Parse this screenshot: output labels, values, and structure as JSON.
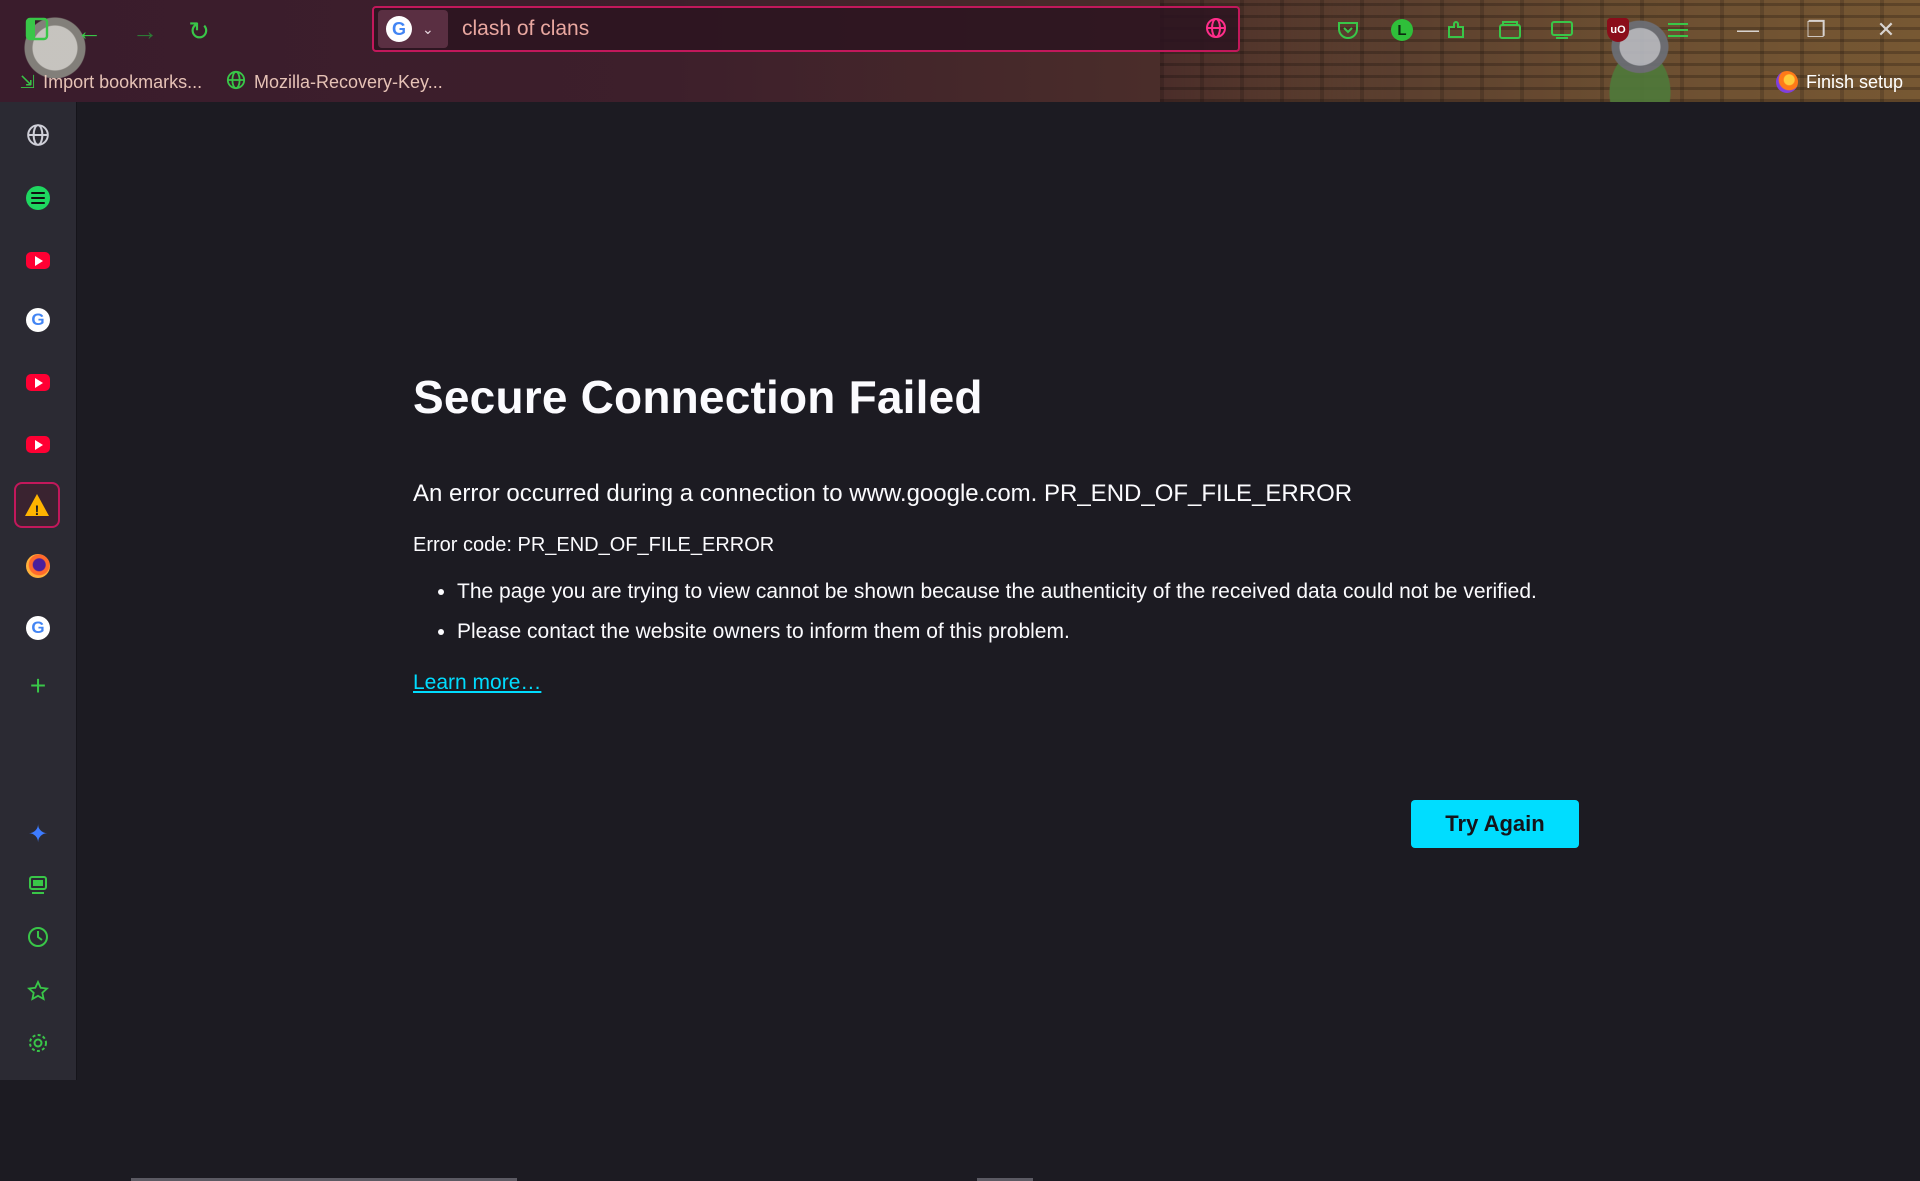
{
  "browser": {
    "url_text": "clash of clans",
    "search_engine_initial": "G",
    "chevron": "⌄"
  },
  "toolbar": {
    "back": "←",
    "forward": "→",
    "reload": "↻",
    "globe_icon": "globe-icon",
    "logo_initial": "L",
    "ublock_label": "uO"
  },
  "window_controls": {
    "minimize": "—",
    "restore": "❐",
    "close": "✕"
  },
  "bookmarks": [
    {
      "label": "Import bookmarks...",
      "icon": "import-icon"
    },
    {
      "label": "Mozilla-Recovery-Key...",
      "icon": "globe-icon"
    }
  ],
  "finish_setup": "Finish setup",
  "sidebar": {
    "items": [
      {
        "icon": "globe-icon"
      },
      {
        "icon": "spotify-icon"
      },
      {
        "icon": "youtube-icon"
      },
      {
        "icon": "google-icon"
      },
      {
        "icon": "youtube-icon"
      },
      {
        "icon": "youtube-icon"
      },
      {
        "icon": "warning-icon",
        "active": true
      },
      {
        "icon": "firefox-icon"
      },
      {
        "icon": "google-icon"
      },
      {
        "icon": "plus-icon"
      }
    ],
    "bottom": [
      "sparkle-icon",
      "extensions-icon",
      "history-icon",
      "star-icon",
      "settings-icon"
    ],
    "google_initial": "G",
    "warning_mark": "!"
  },
  "error": {
    "title": "Secure Connection Failed",
    "description": "An error occurred during a connection to www.google.com. PR_END_OF_FILE_ERROR",
    "code_line": "Error code: PR_END_OF_FILE_ERROR",
    "bullets": [
      "The page you are trying to view cannot be shown because the authenticity of the received data could not be verified.",
      "Please contact the website owners to inform them of this problem."
    ],
    "learn_more": "Learn more…",
    "try_again": "Try Again"
  },
  "colors": {
    "accent": "#00ddff",
    "url_border": "#c2185b",
    "icon_green": "#39c648",
    "background": "#1c1b22",
    "sidebar": "#2b2a33"
  }
}
